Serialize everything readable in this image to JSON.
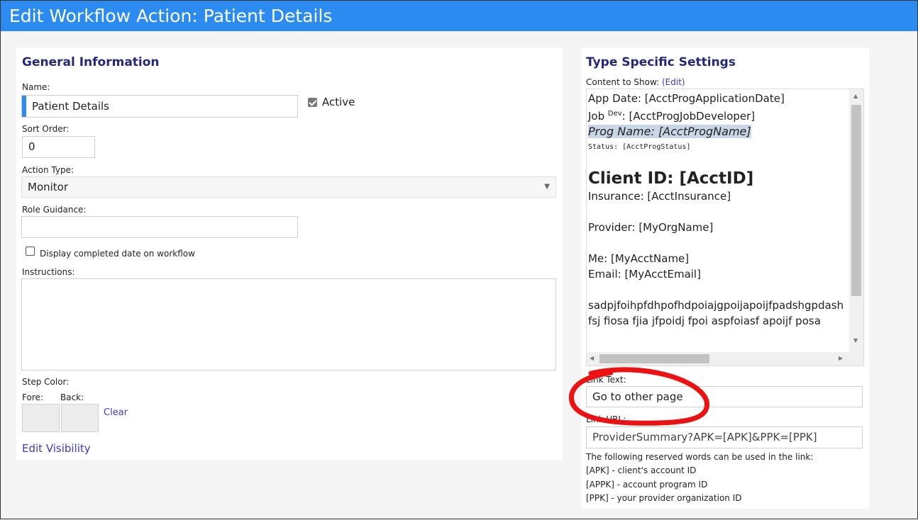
{
  "window": {
    "title": "Edit Workflow Action: Patient Details"
  },
  "general": {
    "heading": "General Information",
    "name_label": "Name:",
    "name_value": "Patient Details",
    "active_label": "Active",
    "active_checked": true,
    "sort_order_label": "Sort Order:",
    "sort_order_value": "0",
    "action_type_label": "Action Type:",
    "action_type_value": "Monitor",
    "role_guidance_label": "Role Guidance:",
    "role_guidance_value": "",
    "display_completed_label": "Display completed date on workflow",
    "display_completed_checked": false,
    "instructions_label": "Instructions:",
    "instructions_value": "",
    "step_color_label": "Step Color:",
    "fore_label": "Fore:",
    "back_label": "Back:",
    "clear_link": "Clear",
    "edit_visibility_link": "Edit Visibility"
  },
  "type_specific": {
    "heading": "Type Specific Settings",
    "content_label": "Content to Show:",
    "content_edit_link": "(Edit)",
    "content": {
      "app_date": "App Date: [AcctProgApplicationDate]",
      "job_prefix": "Job ",
      "job_sup": "Dev",
      "job_suffix": ": [AcctProgJobDeveloper]",
      "prog_name": "Prog Name: [AcctProgName]",
      "status": "Status: [AcctProgStatus]",
      "client_id": "Client ID: [AcctID]",
      "insurance": "Insurance: [AcctInsurance]",
      "provider": "Provider: [MyOrgName]",
      "me": "Me: [MyAcctName]",
      "email": "Email: [MyAcctEmail]",
      "garble1": "sadpjfoihpfdhpofhdpoiajgpoijapoijfpadshgpdash",
      "garble2": "fsj fiosa fjia jfpoidj fpoi aspfoiasf apoijf posa"
    },
    "link_text_label": "Link Text:",
    "link_text_value": "Go to other page",
    "link_url_label": "Link URL:",
    "link_url_value": "ProviderSummary?APK=[APK]&PPK=[PPK]",
    "reserved_intro": "The following reserved words can be used in the link:",
    "reserved": [
      "[APK] - client's account ID",
      "[APPK] - account program ID",
      "[PPK] - your provider organization ID"
    ]
  },
  "colors": {
    "titlebar": "#2b8bf0",
    "heading": "#27277a",
    "annotation": "#ee1111",
    "focus_bar": "#2b8bf0"
  },
  "icons": {
    "dropdown": "chevron-down-icon",
    "checkbox": "checkmark-icon"
  }
}
